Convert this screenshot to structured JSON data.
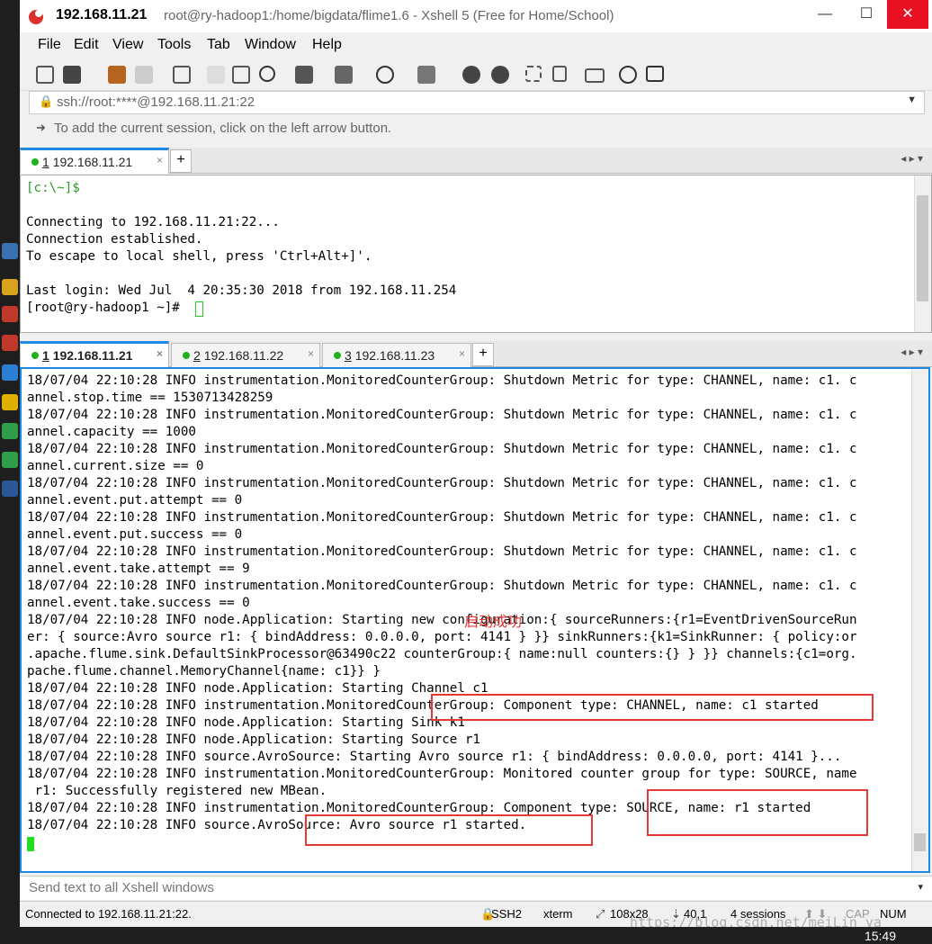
{
  "window": {
    "title_ip": "192.168.11.21",
    "title_rest": "root@ry-hadoop1:/home/bigdata/flime1.6 - Xshell 5 (Free for Home/School)"
  },
  "menu": [
    "File",
    "Edit",
    "View",
    "Tools",
    "Tab",
    "Window",
    "Help"
  ],
  "address": {
    "value": "ssh://root:****@192.168.11.21:22"
  },
  "hint": "To add the current session, click on the left arrow button.",
  "top_tab": {
    "num": "1",
    "label": "192.168.11.21"
  },
  "top_terminal": [
    "[c:\\~]$",
    "",
    "Connecting to 192.168.11.21:22...",
    "Connection established.",
    "To escape to local shell, press 'Ctrl+Alt+]'.",
    "",
    "Last login: Wed Jul  4 20:35:30 2018 from 192.168.11.254",
    "[root@ry-hadoop1 ~]# "
  ],
  "bottom_tabs": [
    {
      "num": "1",
      "label": "192.168.11.21"
    },
    {
      "num": "2",
      "label": "192.168.11.22"
    },
    {
      "num": "3",
      "label": "192.168.11.23"
    }
  ],
  "bottom_terminal": [
    "18/07/04 22:10:28 INFO instrumentation.MonitoredCounterGroup: Shutdown Metric for type: CHANNEL, name: c1. c",
    "annel.stop.time == 1530713428259",
    "18/07/04 22:10:28 INFO instrumentation.MonitoredCounterGroup: Shutdown Metric for type: CHANNEL, name: c1. c",
    "annel.capacity == 1000",
    "18/07/04 22:10:28 INFO instrumentation.MonitoredCounterGroup: Shutdown Metric for type: CHANNEL, name: c1. c",
    "annel.current.size == 0",
    "18/07/04 22:10:28 INFO instrumentation.MonitoredCounterGroup: Shutdown Metric for type: CHANNEL, name: c1. c",
    "annel.event.put.attempt == 0",
    "18/07/04 22:10:28 INFO instrumentation.MonitoredCounterGroup: Shutdown Metric for type: CHANNEL, name: c1. c",
    "annel.event.put.success == 0",
    "18/07/04 22:10:28 INFO instrumentation.MonitoredCounterGroup: Shutdown Metric for type: CHANNEL, name: c1. c",
    "annel.event.take.attempt == 9",
    "18/07/04 22:10:28 INFO instrumentation.MonitoredCounterGroup: Shutdown Metric for type: CHANNEL, name: c1. c",
    "annel.event.take.success == 0",
    "18/07/04 22:10:28 INFO node.Application: Starting new configuration:{ sourceRunners:{r1=EventDrivenSourceRun",
    "er: { source:Avro source r1: { bindAddress: 0.0.0.0, port: 4141 } }} sinkRunners:{k1=SinkRunner: { policy:or",
    ".apache.flume.sink.DefaultSinkProcessor@63490c22 counterGroup:{ name:null counters:{} } }} channels:{c1=org.",
    "pache.flume.channel.MemoryChannel{name: c1}} }",
    "18/07/04 22:10:28 INFO node.Application: Starting Channel c1",
    "18/07/04 22:10:28 INFO instrumentation.MonitoredCounterGroup: Component type: CHANNEL, name: c1 started",
    "18/07/04 22:10:28 INFO node.Application: Starting Sink k1",
    "18/07/04 22:10:28 INFO node.Application: Starting Source r1",
    "18/07/04 22:10:28 INFO source.AvroSource: Starting Avro source r1: { bindAddress: 0.0.0.0, port: 4141 }...",
    "18/07/04 22:10:28 INFO instrumentation.MonitoredCounterGroup: Monitored counter group for type: SOURCE, name",
    " r1: Successfully registered new MBean.",
    "18/07/04 22:10:28 INFO instrumentation.MonitoredCounterGroup: Component type: SOURCE, name: r1 started",
    "18/07/04 22:10:28 INFO source.AvroSource: Avro source r1 started."
  ],
  "annotation": "启动成功",
  "send_bar": "Send text to all Xshell windows",
  "status": {
    "connected": "Connected to 192.168.11.21:22.",
    "protocol": "SSH2",
    "term": "xterm",
    "size": "108x28",
    "cursor": "40,1",
    "sessions": "4 sessions",
    "cap": "CAP",
    "num": "NUM"
  },
  "watermark": "https://blog.csdn.net/meiLin_ya",
  "clock": "15:49",
  "colors": {
    "accent": "#1e88e5",
    "session_dot": "#1db31d",
    "annotation": "#e53935",
    "close": "#e81123"
  }
}
